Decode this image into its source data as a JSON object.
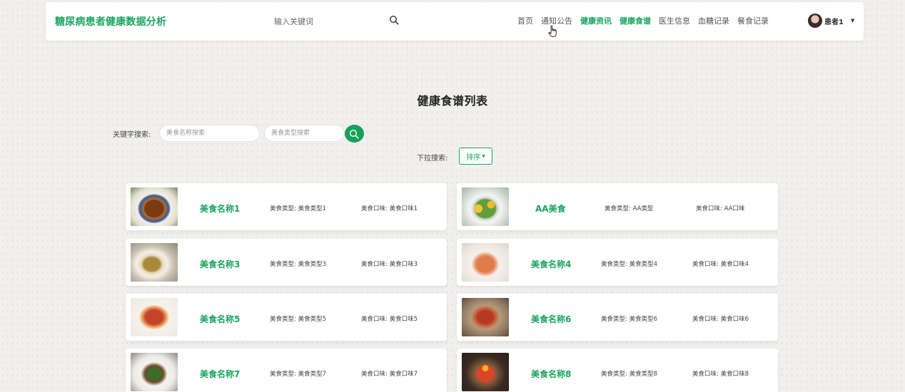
{
  "header": {
    "title": "糖尿病患者健康数据分析",
    "search_placeholder": "输入关键词",
    "nav": [
      "首页",
      "通知公告",
      "健康资讯",
      "健康食谱",
      "医生信息",
      "血糖记录",
      "餐食记录"
    ],
    "user_name": "患者1"
  },
  "main": {
    "title": "健康食谱列表",
    "keyword_label": "关键字搜索:",
    "name_placeholder": "美食名称搜索",
    "type_placeholder": "美食类型搜索",
    "dropdown_label": "下拉搜索:",
    "sort_label": "排序"
  },
  "items": [
    {
      "name": "美食名称1",
      "type": "美食类型: 美食类型1",
      "taste": "美食口味: 美食口味1"
    },
    {
      "name": "AA美食",
      "type": "美食类型: AA类型",
      "taste": "美食口味: AA口味"
    },
    {
      "name": "美食名称3",
      "type": "美食类型: 美食类型3",
      "taste": "美食口味: 美食口味3"
    },
    {
      "name": "美食名称4",
      "type": "美食类型: 美食类型4",
      "taste": "美食口味: 美食口味4"
    },
    {
      "name": "美食名称5",
      "type": "美食类型: 美食类型5",
      "taste": "美食口味: 美食口味5"
    },
    {
      "name": "美食名称6",
      "type": "美食类型: 美食类型6",
      "taste": "美食口味: 美食口味6"
    },
    {
      "name": "美食名称7",
      "type": "美食类型: 美食类型7",
      "taste": "美食口味: 美食口味7"
    },
    {
      "name": "美食名称8",
      "type": "美食类型: 美食类型8",
      "taste": "美食口味: 美食口味8"
    }
  ],
  "colors": {
    "accent": "#1aa55f",
    "background": "#f1f0ee"
  }
}
